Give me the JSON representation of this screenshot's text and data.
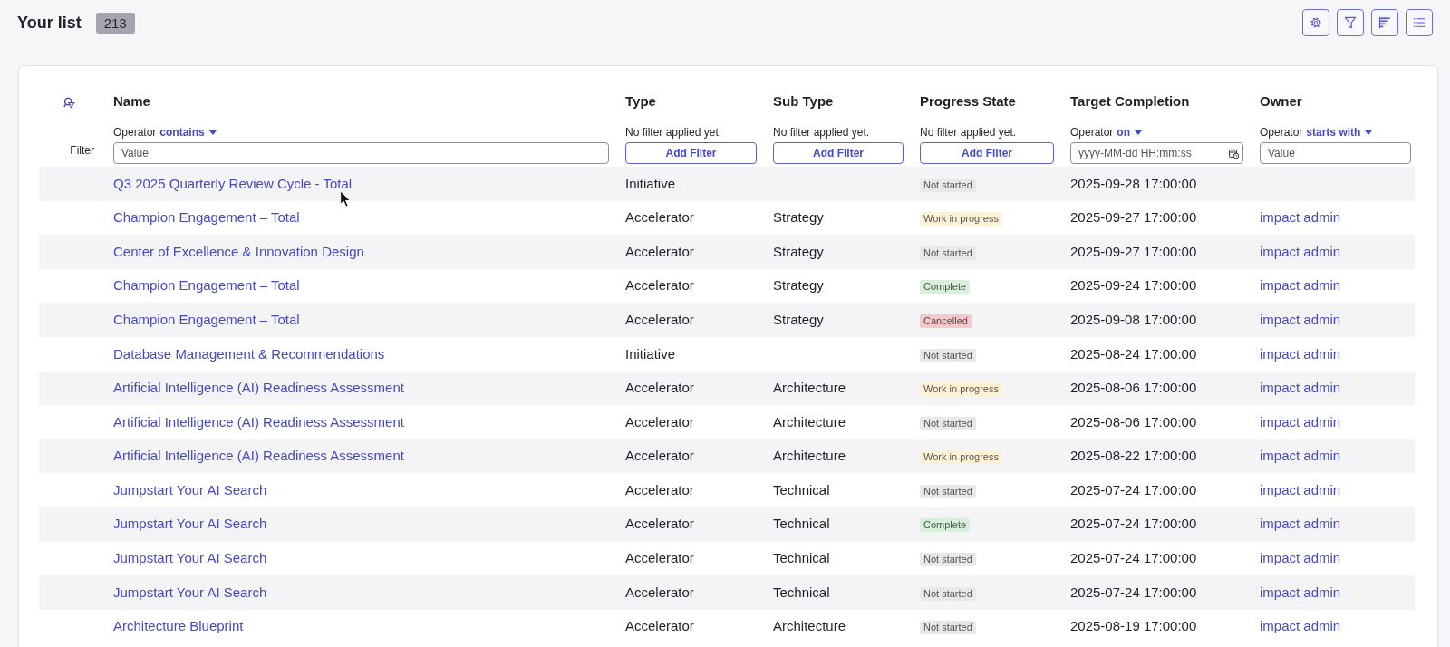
{
  "header": {
    "title": "Your list",
    "count": "213"
  },
  "table": {
    "filter_label": "Filter",
    "columns": [
      {
        "label": "Name",
        "filter": {
          "kind": "text",
          "operator_label": "Operator",
          "operator": "contains",
          "placeholder": "Value"
        }
      },
      {
        "label": "Type",
        "filter": {
          "kind": "none",
          "note": "No filter applied yet.",
          "button": "Add Filter"
        }
      },
      {
        "label": "Sub Type",
        "filter": {
          "kind": "none",
          "note": "No filter applied yet.",
          "button": "Add Filter"
        }
      },
      {
        "label": "Progress State",
        "filter": {
          "kind": "none",
          "note": "No filter applied yet.",
          "button": "Add Filter"
        }
      },
      {
        "label": "Target Completion",
        "filter": {
          "kind": "date",
          "operator_label": "Operator",
          "operator": "on",
          "placeholder": "yyyy-MM-dd HH:mm:ss"
        }
      },
      {
        "label": "Owner",
        "filter": {
          "kind": "text",
          "operator_label": "Operator",
          "operator": "starts with",
          "placeholder": "Value"
        }
      }
    ],
    "rows": [
      {
        "name": "Q3 2025 Quarterly Review Cycle - Total",
        "type": "Initiative",
        "progress": {
          "label": "Not started",
          "color": "#e8e8eb"
        },
        "target_completion": "2025-09-28 17:00:00"
      },
      {
        "name": "Champion Engagement – Total",
        "type": "Accelerator",
        "sub_type": "Strategy",
        "progress": {
          "label": "Work in progress",
          "color": "#fdf2d6"
        },
        "target_completion": "2025-09-27 17:00:00",
        "owner": "impact admin"
      },
      {
        "name": "Center of Excellence & Innovation Design",
        "type": "Accelerator",
        "sub_type": "Strategy",
        "progress": {
          "label": "Not started",
          "color": "#e8e8eb"
        },
        "target_completion": "2025-09-27 17:00:00",
        "owner": "impact admin"
      },
      {
        "name": "Champion Engagement – Total",
        "type": "Accelerator",
        "sub_type": "Strategy",
        "progress": {
          "label": "Complete",
          "color": "#d6f0d9"
        },
        "target_completion": "2025-09-24 17:00:00",
        "owner": "impact admin"
      },
      {
        "name": "Champion Engagement – Total",
        "type": "Accelerator",
        "sub_type": "Strategy",
        "progress": {
          "label": "Cancelled",
          "color": "#f6c8cb"
        },
        "target_completion": "2025-09-08 17:00:00",
        "owner": "impact admin"
      },
      {
        "name": "Database Management & Recommendations",
        "type": "Initiative",
        "progress": {
          "label": "Not started",
          "color": "#e8e8eb"
        },
        "target_completion": "2025-08-24 17:00:00",
        "owner": "impact admin"
      },
      {
        "name": "Artificial Intelligence (AI) Readiness Assessment",
        "type": "Accelerator",
        "sub_type": "Architecture",
        "progress": {
          "label": "Work in progress",
          "color": "#fdf2d6"
        },
        "target_completion": "2025-08-06 17:00:00",
        "owner": "impact admin"
      },
      {
        "name": "Artificial Intelligence (AI) Readiness Assessment",
        "type": "Accelerator",
        "sub_type": "Architecture",
        "progress": {
          "label": "Not started",
          "color": "#e8e8eb"
        },
        "target_completion": "2025-08-06 17:00:00",
        "owner": "impact admin"
      },
      {
        "name": "Artificial Intelligence (AI) Readiness Assessment",
        "type": "Accelerator",
        "sub_type": "Architecture",
        "progress": {
          "label": "Work in progress",
          "color": "#fdf2d6"
        },
        "target_completion": "2025-08-22 17:00:00",
        "owner": "impact admin"
      },
      {
        "name": "Jumpstart Your AI Search",
        "type": "Accelerator",
        "sub_type": "Technical",
        "progress": {
          "label": "Not started",
          "color": "#e8e8eb"
        },
        "target_completion": "2025-07-24 17:00:00",
        "owner": "impact admin"
      },
      {
        "name": "Jumpstart Your AI Search",
        "type": "Accelerator",
        "sub_type": "Technical",
        "progress": {
          "label": "Complete",
          "color": "#d6f0d9"
        },
        "target_completion": "2025-07-24 17:00:00",
        "owner": "impact admin"
      },
      {
        "name": "Jumpstart Your AI Search",
        "type": "Accelerator",
        "sub_type": "Technical",
        "progress": {
          "label": "Not started",
          "color": "#e8e8eb"
        },
        "target_completion": "2025-07-24 17:00:00",
        "owner": "impact admin"
      },
      {
        "name": "Jumpstart Your AI Search",
        "type": "Accelerator",
        "sub_type": "Technical",
        "progress": {
          "label": "Not started",
          "color": "#e8e8eb"
        },
        "target_completion": "2025-07-24 17:00:00",
        "owner": "impact admin"
      },
      {
        "name": "Architecture Blueprint",
        "type": "Accelerator",
        "sub_type": "Architecture",
        "progress": {
          "label": "Not started",
          "color": "#e8e8eb"
        },
        "target_completion": "2025-08-19 17:00:00",
        "owner": "impact admin"
      }
    ]
  }
}
